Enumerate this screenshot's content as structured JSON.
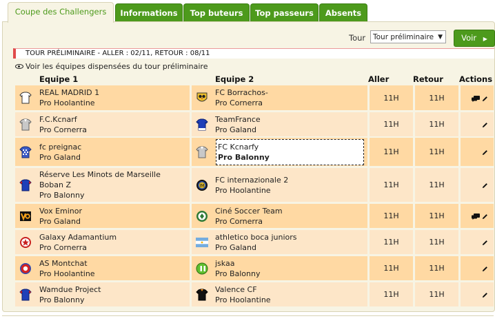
{
  "tabs": [
    {
      "label": "Coupe des Challengers",
      "active": true
    },
    {
      "label": "Informations",
      "active": false
    },
    {
      "label": "Top buteurs",
      "active": false
    },
    {
      "label": "Top passeurs",
      "active": false
    },
    {
      "label": "Absents",
      "active": false
    }
  ],
  "toolbar": {
    "tour_label": "Tour",
    "tour_selected": "Tour préliminaire",
    "voir_label": "Voir"
  },
  "round_header": "TOUR PRÉLIMINAIRE - ALLER : 02/11, RETOUR : 08/11",
  "voir_equipes": "Voir les équipes dispensées du tour préliminaire",
  "columns": {
    "team1": "Equipe 1",
    "team2": "Equipe 2",
    "aller": "Aller",
    "retour": "Retour",
    "actions": "Actions"
  },
  "matches": [
    {
      "team1": {
        "lines": [
          "REAL MADRID 1"
        ],
        "division": "Pro Hoolantine",
        "icon": "white-shirt-icon"
      },
      "team2": {
        "lines": [
          "FC Borrachos-"
        ],
        "division": "Pro Cornerra",
        "icon": "owl-crest-icon"
      },
      "aller": "11H",
      "retour": "11H",
      "has_chat": true
    },
    {
      "team1": {
        "lines": [
          "F.C.Kcnarf"
        ],
        "division": "Pro Cornerra",
        "icon": "grey-shirt-icon"
      },
      "team2": {
        "lines": [
          "TeamFrance"
        ],
        "division": "Pro Galand",
        "icon": "blue-shirt-icon"
      },
      "aller": "11H",
      "retour": "11H",
      "has_chat": false
    },
    {
      "team1": {
        "lines": [
          "fc preignac"
        ],
        "division": "Pro Galand",
        "icon": "checkered-shirt-icon"
      },
      "team2": {
        "lines": [
          "FC Kcnarfy"
        ],
        "division": "Pro Balonny",
        "icon": "grey-shirt-icon",
        "highlighted": true
      },
      "aller": "11H",
      "retour": "11H",
      "has_chat": false
    },
    {
      "team1": {
        "lines": [
          "Réserve Les Minots de Marseille",
          "Boban Z"
        ],
        "division": "Pro Balonny",
        "icon": "blue-red-shirt-icon"
      },
      "team2": {
        "lines": [
          "FC internazionale 2"
        ],
        "division": "Pro Hoolantine",
        "icon": "inter-crest-icon"
      },
      "aller": "11H",
      "retour": "11H",
      "has_chat": false
    },
    {
      "team1": {
        "lines": [
          "Vox Eminor"
        ],
        "division": "Pro Galand",
        "icon": "vox-logo-icon"
      },
      "team2": {
        "lines": [
          "Ciné Soccer Team"
        ],
        "division": "Pro Cornerra",
        "icon": "green-crest-icon"
      },
      "aller": "11H",
      "retour": "11H",
      "has_chat": true
    },
    {
      "team1": {
        "lines": [
          "Galaxy Adamantium"
        ],
        "division": "Pro Cornerra",
        "icon": "red-star-icon"
      },
      "team2": {
        "lines": [
          "athletico boca juniors"
        ],
        "division": "Pro Galand",
        "icon": "argentina-flag-icon"
      },
      "aller": "11H",
      "retour": "11H",
      "has_chat": false
    },
    {
      "team1": {
        "lines": [
          "AS Montchat"
        ],
        "division": "Pro Hoolantine",
        "icon": "red-crest-icon"
      },
      "team2": {
        "lines": [
          "jskaa"
        ],
        "division": "Pro Balonny",
        "icon": "green-white-crest-icon"
      },
      "aller": "11H",
      "retour": "11H",
      "has_chat": false
    },
    {
      "team1": {
        "lines": [
          "Wamdue Project"
        ],
        "division": "Pro Balonny",
        "icon": "blue-red-shirt-icon"
      },
      "team2": {
        "lines": [
          "Valence CF"
        ],
        "division": "Pro Hoolantine",
        "icon": "black-orange-shirt-icon"
      },
      "aller": "11H",
      "retour": "11H",
      "has_chat": false
    }
  ],
  "colors": {
    "tab_green": "#4d9a1c",
    "row_orange": "#ffd9a3",
    "row_light": "#fde6c8",
    "round_accent": "#e04b4b"
  }
}
